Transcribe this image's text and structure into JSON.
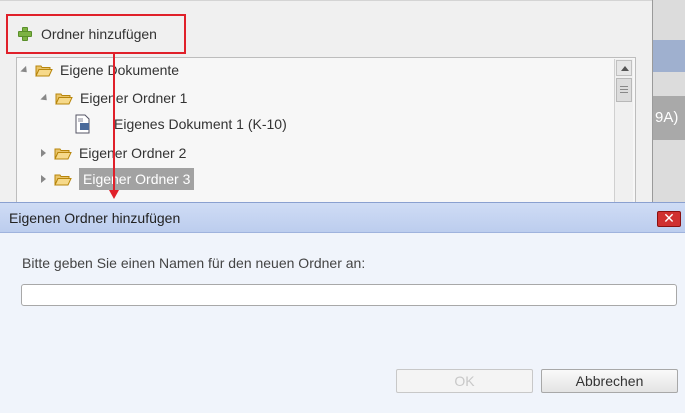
{
  "toolbar": {
    "add_folder_label": "Ordner hinzufügen",
    "add_icon": "plus-icon"
  },
  "tree": {
    "items": [
      {
        "label": "Eigene Dokumente",
        "level": 0,
        "expanded": true,
        "type": "folder"
      },
      {
        "label": "Eigener Ordner 1",
        "level": 1,
        "expanded": true,
        "type": "folder"
      },
      {
        "label": "Eigenes Dokument 1 (K-10)",
        "level": 2,
        "type": "document"
      },
      {
        "label": "Eigener Ordner 2",
        "level": 1,
        "expanded": false,
        "type": "folder"
      },
      {
        "label": "Eigener Ordner 3",
        "level": 1,
        "expanded": false,
        "type": "folder",
        "selected": true
      }
    ]
  },
  "right_panel": {
    "partial_text": "9A)"
  },
  "dialog": {
    "title": "Eigenen Ordner hinzufügen",
    "close_label": "✕",
    "prompt": "Bitte geben Sie einen Namen für den neuen Ordner an:",
    "input_value": "",
    "ok_label": "OK",
    "cancel_label": "Abbrechen"
  },
  "colors": {
    "highlight": "#e0202a",
    "selected_bg": "#a2a2a2",
    "dialog_header": "#bccdee"
  }
}
